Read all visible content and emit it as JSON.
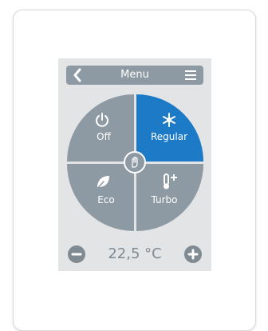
{
  "menu_bar": {
    "title": "Menu",
    "back_icon": "chevron-left-icon",
    "menu_icon": "hamburger-icon"
  },
  "modes": [
    {
      "label": "Off",
      "icon": "power-icon",
      "selected": false
    },
    {
      "label": "Regular",
      "icon": "snowflake-icon",
      "selected": true
    },
    {
      "label": "Eco",
      "icon": "leaf-icon",
      "selected": false
    },
    {
      "label": "Turbo",
      "icon": "thermometer-plus-icon",
      "selected": false
    }
  ],
  "center_icon": "hand-icon",
  "temperature": {
    "value": "22,5 °C",
    "decrease_icon": "minus-icon",
    "increase_icon": "plus-icon"
  },
  "colors": {
    "selected": "#1c7ac7",
    "tile": "#8e9aa3",
    "panel": "#e2e4e6"
  }
}
